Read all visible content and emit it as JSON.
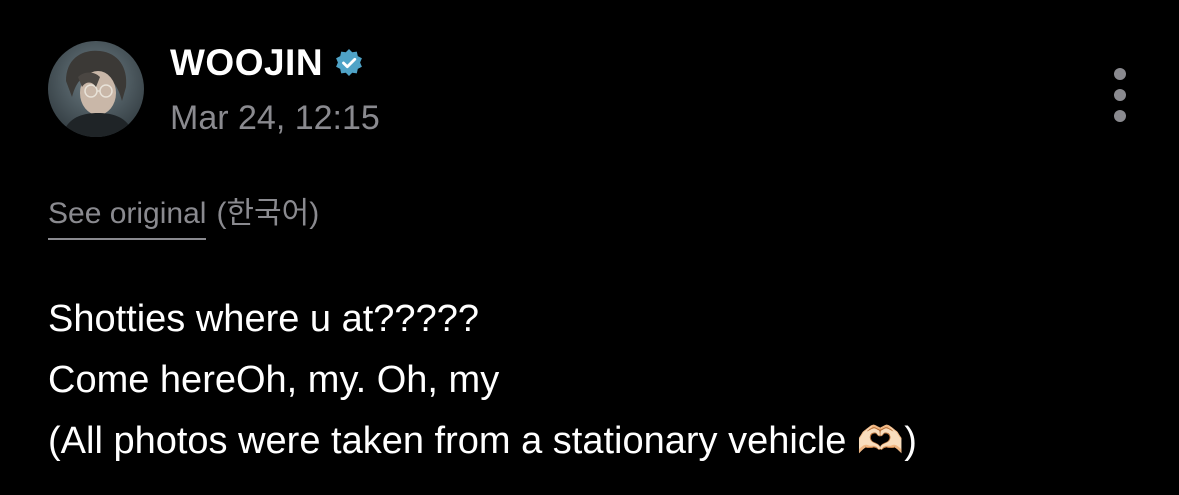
{
  "author": {
    "name": "WOOJIN",
    "verified": true,
    "verified_badge_color": "#4fa3c7",
    "avatar_icon": "profile-photo-avatar"
  },
  "post": {
    "timestamp": "Mar 24, 12:15",
    "translation": {
      "see_original_label": "See original",
      "language_label": "(한국어)"
    },
    "lines": [
      "Shotties where u at?????",
      "Come hereOh, my. Oh, my",
      "(All photos were taken from a stationary vehicle 🫶🏻)"
    ]
  },
  "menu": {
    "icon": "more-vertical-icon"
  },
  "colors": {
    "background": "#000000",
    "text": "#ffffff",
    "secondary_text": "#8a8a8f"
  }
}
